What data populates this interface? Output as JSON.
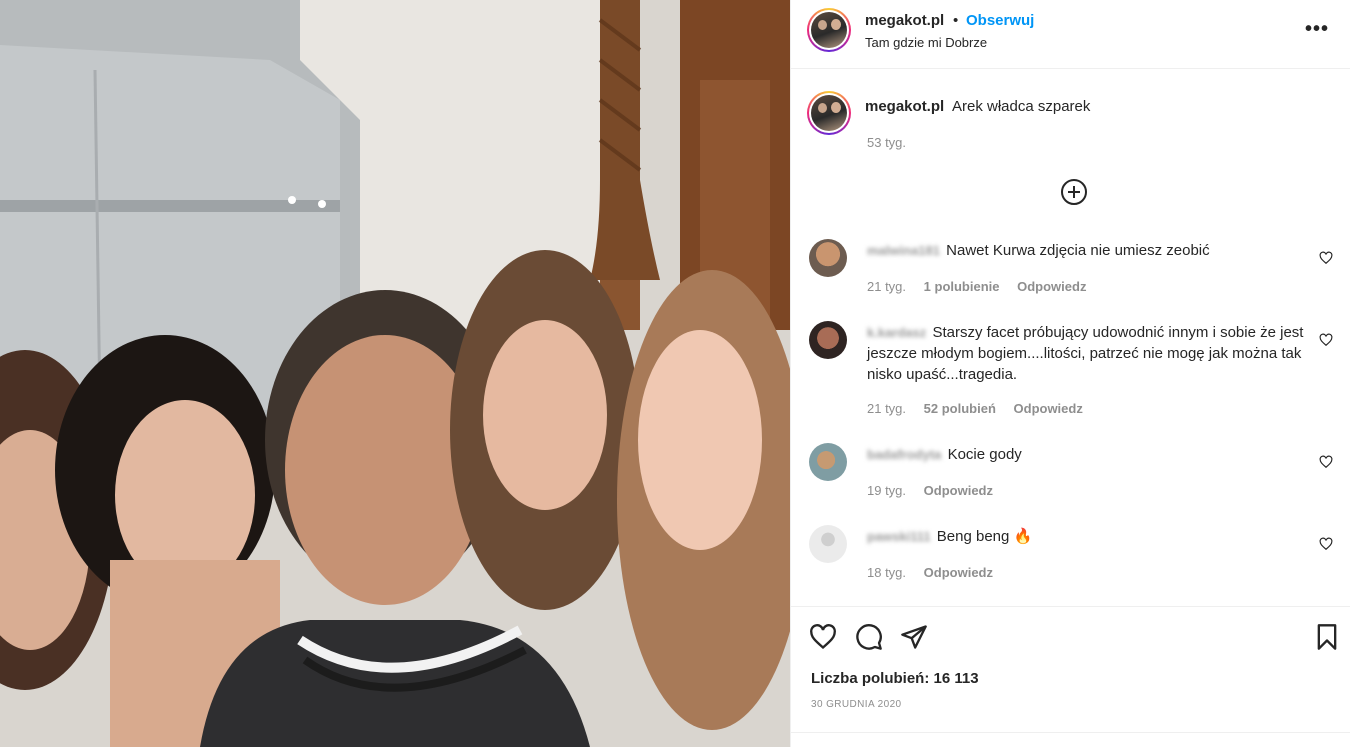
{
  "post": {
    "username": "megakot.pl",
    "follow_label": "Obserwuj",
    "separator": "•",
    "location": "Tam gdzie mi Dobrze",
    "more_icon": "more-horizontal-icon",
    "more_label": "•••"
  },
  "caption": {
    "username": "megakot.pl",
    "text": "Arek władca szparek",
    "time": "53 tyg."
  },
  "load_more_icon": "plus-circle-icon",
  "comments": [
    {
      "username": "malwina181",
      "text": "Nawet Kurwa zdjęcia nie umiesz zeobić",
      "time": "21 tyg.",
      "likes": "1 polubienie",
      "reply": "Odpowiedz",
      "avatar_color": "#7a6a5c"
    },
    {
      "username": "k.kardasz",
      "text": "Starszy facet próbujący udowodnić innym i sobie że jest jeszcze młodym bogiem....litości, patrzeć nie mogę jak można tak nisko upaść...tragedia.",
      "time": "21 tyg.",
      "likes": "52 polubień",
      "reply": "Odpowiedz",
      "avatar_color": "#3a2e2a"
    },
    {
      "username": "badafrodyta",
      "text": "Kocie gody",
      "time": "19 tyg.",
      "likes": "",
      "reply": "Odpowiedz",
      "avatar_color": "#7c8a8c"
    },
    {
      "username": "pawski111",
      "text": "Beng beng 🔥",
      "time": "18 tyg.",
      "likes": "",
      "reply": "Odpowiedz",
      "avatar_color": "#e4e4e4"
    }
  ],
  "actions": {
    "like_icon": "heart-icon",
    "comment_icon": "comment-icon",
    "share_icon": "send-icon",
    "save_icon": "bookmark-icon"
  },
  "likes_text": "Liczba polubień: 16 113",
  "date_text": "30 GRUDNIA 2020"
}
